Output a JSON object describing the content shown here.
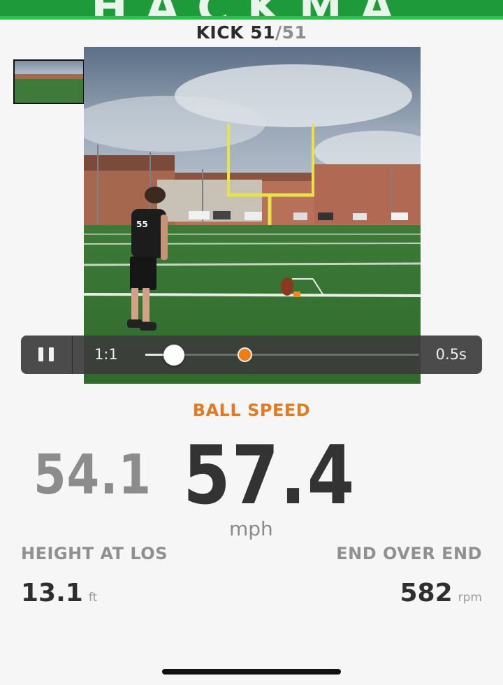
{
  "header": {
    "kick_label": "KICK",
    "kick_current": "51",
    "kick_separator": "/",
    "kick_total": "51"
  },
  "thumbnails": [
    {
      "id": "camera-1",
      "selected": false
    },
    {
      "id": "camera-2",
      "selected": true
    }
  ],
  "video": {
    "jersey_number": "55"
  },
  "playback": {
    "speed_label": "1:1",
    "time_label": "0.5s",
    "progress": 0.1
  },
  "metrics": {
    "title": "BALL SPEED",
    "secondary_value": "54.1",
    "primary_value": "57.4",
    "primary_unit": "mph",
    "height_label": "HEIGHT AT LOS",
    "height_value": "13.1",
    "height_unit": "ft",
    "rotation_label": "END OVER END",
    "rotation_value": "582",
    "rotation_unit": "rpm"
  },
  "colors": {
    "accent": "#e07a23",
    "banner": "#1f9a3a",
    "goalpost": "#e9e24a"
  }
}
